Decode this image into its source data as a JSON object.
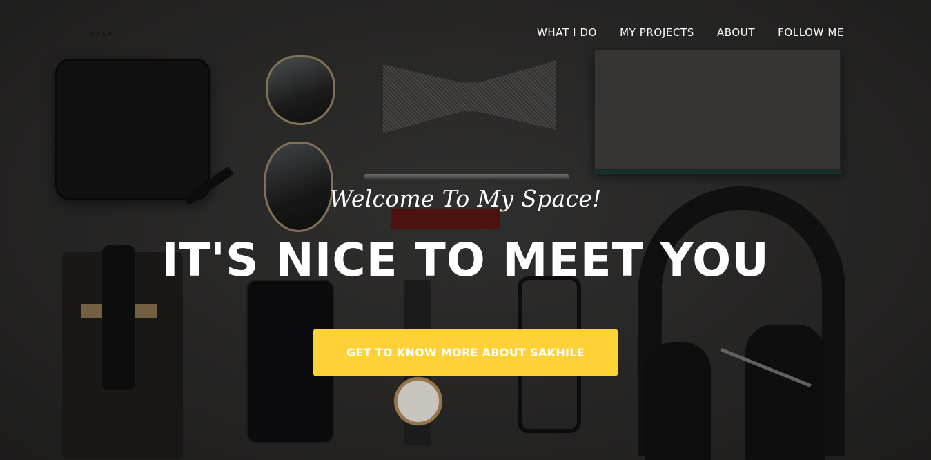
{
  "brand": {
    "logo_text": "SASH",
    "logo_mark": "™"
  },
  "nav": {
    "items": [
      {
        "label": "WHAT I DO"
      },
      {
        "label": "MY PROJECTS"
      },
      {
        "label": "ABOUT"
      },
      {
        "label": "FOLLOW ME"
      }
    ]
  },
  "hero": {
    "subheading": "Welcome To My Space!",
    "heading": "IT'S NICE TO MEET YOU",
    "cta_label": "GET TO KNOW MORE ABOUT SAKHILE"
  },
  "colors": {
    "accent": "#fed136",
    "text": "#ffffff",
    "background": "#2f2e2d"
  }
}
